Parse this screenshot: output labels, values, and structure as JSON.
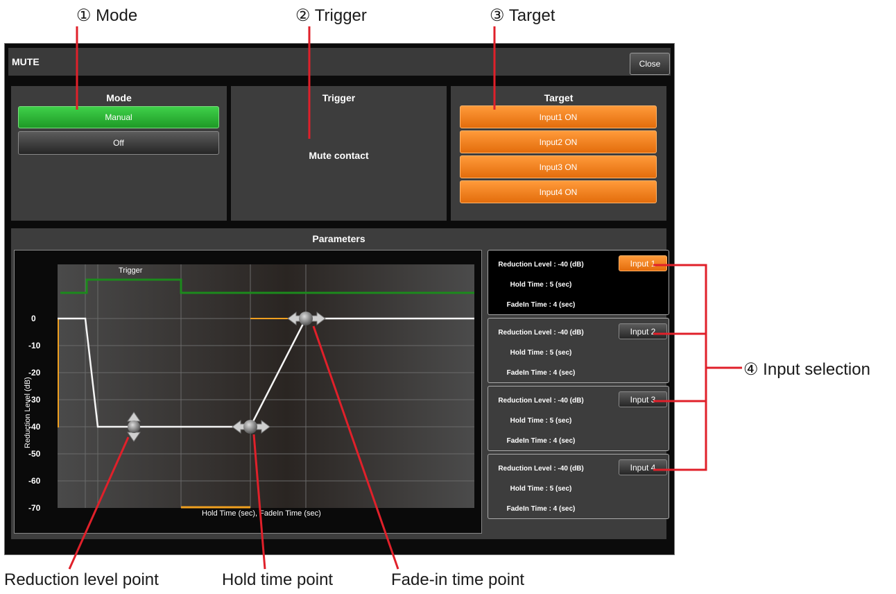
{
  "callouts": {
    "mode": "① Mode",
    "trigger": "② Trigger",
    "target": "③ Target",
    "input_selection": "④ Input selection",
    "reduction_point": "Reduction level point",
    "hold_point": "Hold time point",
    "fadein_point": "Fade-in time point"
  },
  "window": {
    "title": "MUTE",
    "close_label": "Close"
  },
  "mode_panel": {
    "title": "Mode",
    "options": [
      "Manual",
      "Off"
    ],
    "selected": "Manual"
  },
  "trigger_panel": {
    "title": "Trigger",
    "value": "Mute contact"
  },
  "target_panel": {
    "title": "Target",
    "items": [
      "Input1 ON",
      "Input2 ON",
      "Input3 ON",
      "Input4 ON"
    ]
  },
  "parameters": {
    "title": "Parameters",
    "graph": {
      "trigger_label": "Trigger",
      "y_label": "Reduction Level (dB)",
      "x_label": "Hold Time (sec), FadeIn Time (sec)",
      "y_ticks": [
        "0",
        "-10",
        "-20",
        "-30",
        "-40",
        "-50",
        "-60",
        "-70"
      ]
    },
    "inputs": [
      {
        "button": "Input 1",
        "reduction": "Reduction Level : -40 (dB)",
        "hold": "Hold Time : 5 (sec)",
        "fadein": "FadeIn Time : 4 (sec)",
        "selected": true
      },
      {
        "button": "Input 2",
        "reduction": "Reduction Level : -40 (dB)",
        "hold": "Hold Time : 5 (sec)",
        "fadein": "FadeIn Time : 4 (sec)",
        "selected": false
      },
      {
        "button": "Input 3",
        "reduction": "Reduction Level : -40 (dB)",
        "hold": "Hold Time : 5 (sec)",
        "fadein": "FadeIn Time : 4 (sec)",
        "selected": false
      },
      {
        "button": "Input 4",
        "reduction": "Reduction Level : -40 (dB)",
        "hold": "Hold Time : 5 (sec)",
        "fadein": "FadeIn Time : 4 (sec)",
        "selected": false
      }
    ]
  },
  "colors": {
    "accent_orange": "#f08020",
    "accent_green": "#2db836",
    "callout_red": "#e0202a",
    "trigger_green": "#1c8a1c"
  }
}
